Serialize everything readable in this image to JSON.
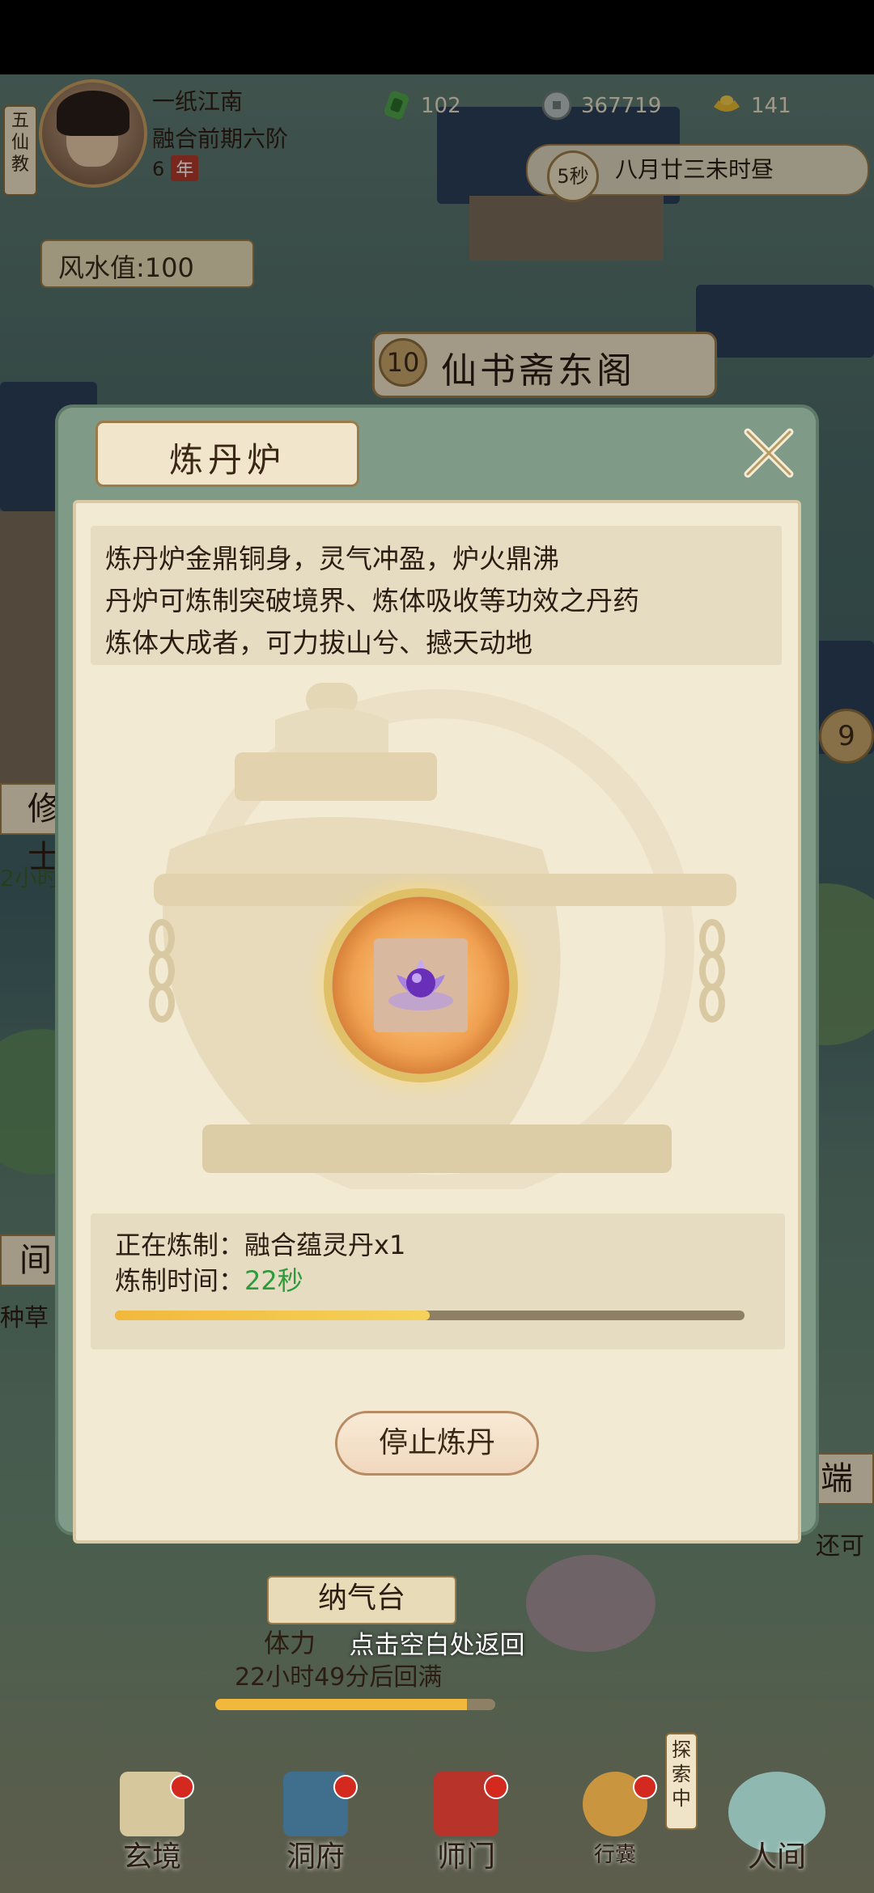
{
  "hud": {
    "sect": "五仙教",
    "player_name": "一纸江南",
    "player_rank": "融合前期六阶",
    "player_age": "6",
    "age_unit": "年",
    "jade": "102",
    "coins": "367719",
    "gold": "141",
    "countdown": "5秒",
    "game_time": "八月廿三未时昼",
    "fengshui": "风水值:100"
  },
  "map": {
    "building_number": "10",
    "building_name": "仙书斋东阁",
    "side_label_left": "修士",
    "side_time_left": "2小时",
    "side_label_left2": "间",
    "side_text_left2": "种草",
    "side_number_right": "9",
    "side_label_right": "端",
    "side_text_right": "还可"
  },
  "modal": {
    "title": "炼丹炉",
    "description": [
      "炼丹炉金鼎铜身，灵气冲盈，炉火鼎沸",
      "丹炉可炼制突破境界、炼体吸收等功效之丹药",
      "炼体大成者，可力拔山兮、撼天动地"
    ],
    "refining_label": "正在炼制：融合蕴灵丹x1",
    "time_label": "炼制时间：",
    "time_value": "22秒",
    "progress": 0.5,
    "stop_button": "停止炼丹"
  },
  "tap_hint": "点击空白处返回",
  "stamina": {
    "building": "纳气台",
    "label": "体力",
    "refill": "22小时49分后回满",
    "progress": 0.9
  },
  "nav": {
    "items": [
      "玄境",
      "洞府",
      "师门",
      "行囊",
      "人间"
    ],
    "explore": "探索中"
  },
  "colors": {
    "progress_fill": "#f2b83c",
    "time_green": "#2e9a3c",
    "badge_red": "#d3291f"
  }
}
